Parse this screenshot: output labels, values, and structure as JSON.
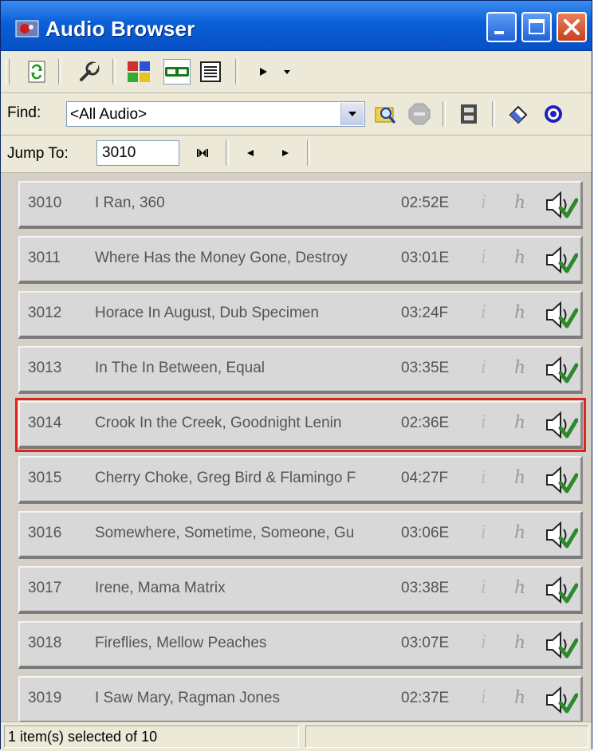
{
  "window": {
    "title": "Audio Browser"
  },
  "find": {
    "label": "Find:",
    "value": "<All Audio>"
  },
  "jump": {
    "label": "Jump To:",
    "value": "3010"
  },
  "rows": [
    {
      "num": "3010",
      "title": "I Ran, 360",
      "duration": "02:52E",
      "info": "i",
      "h": "h"
    },
    {
      "num": "3011",
      "title": "Where Has the Money Gone, Destroy",
      "duration": "03:01E",
      "info": "i",
      "h": "h"
    },
    {
      "num": "3012",
      "title": "Horace In August, Dub Specimen",
      "duration": "03:24F",
      "info": "i",
      "h": "h"
    },
    {
      "num": "3013",
      "title": "In The In Between, Equal",
      "duration": "03:35E",
      "info": "i",
      "h": "h"
    },
    {
      "num": "3014",
      "title": "Crook In the Creek, Goodnight Lenin",
      "duration": "02:36E",
      "info": "i",
      "h": "h",
      "selected": true
    },
    {
      "num": "3015",
      "title": "Cherry Choke, Greg Bird & Flamingo F",
      "duration": "04:27F",
      "info": "i",
      "h": "h"
    },
    {
      "num": "3016",
      "title": "Somewhere, Sometime, Someone, Gu",
      "duration": "03:06E",
      "info": "i",
      "h": "h"
    },
    {
      "num": "3017",
      "title": "Irene, Mama Matrix",
      "duration": "03:38E",
      "info": "i",
      "h": "h"
    },
    {
      "num": "3018",
      "title": "Fireflies, Mellow Peaches",
      "duration": "03:07E",
      "info": "i",
      "h": "h"
    },
    {
      "num": "3019",
      "title": "I Saw Mary, Ragman Jones",
      "duration": "02:37E",
      "info": "i",
      "h": "h"
    }
  ],
  "status": {
    "text": "1 item(s) selected of 10"
  },
  "colors": {
    "titlebar": "#0a5fd8",
    "selection_outline": "#e0241c",
    "row_bg": "#d8d8d8"
  }
}
